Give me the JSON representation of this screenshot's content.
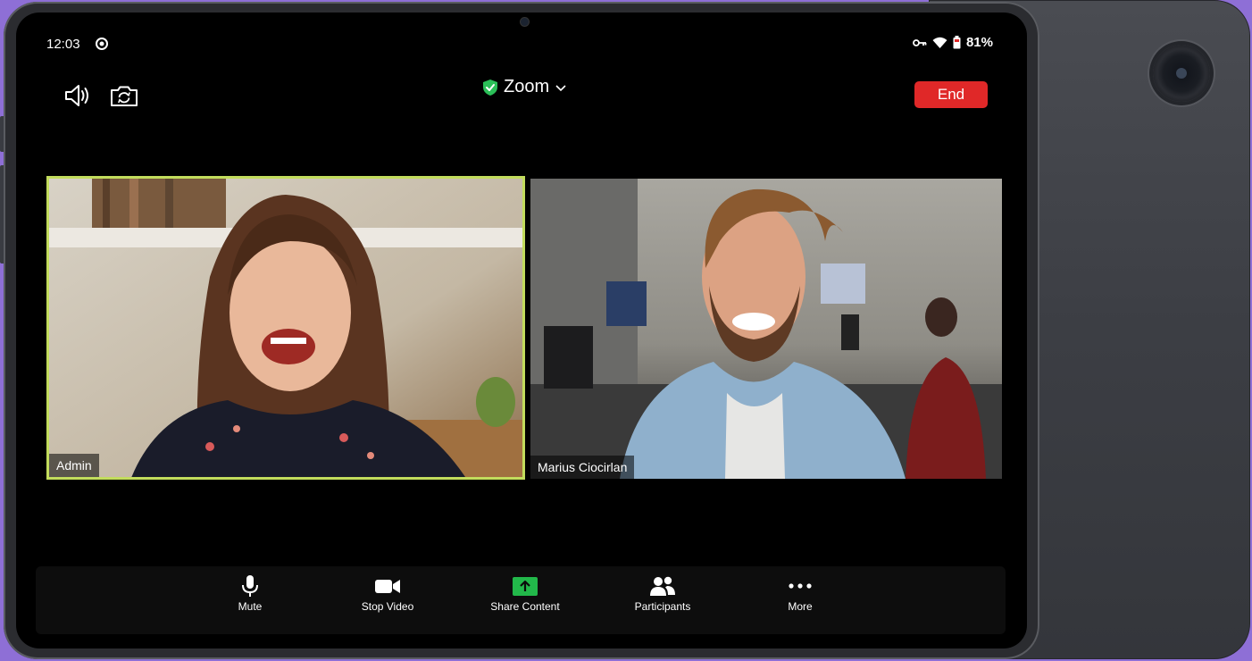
{
  "status_bar": {
    "time": "12:03",
    "battery": "81%"
  },
  "header": {
    "title": "Zoom",
    "end_label": "End"
  },
  "participants": [
    {
      "name": "Admin",
      "active_speaker": true
    },
    {
      "name": "Marius Ciocirlan",
      "active_speaker": false
    }
  ],
  "toolbar": {
    "items": [
      {
        "label": "Mute",
        "icon": "microphone-icon"
      },
      {
        "label": "Stop Video",
        "icon": "video-camera-icon"
      },
      {
        "label": "Share Content",
        "icon": "share-screen-icon"
      },
      {
        "label": "Participants",
        "icon": "participants-icon"
      },
      {
        "label": "More",
        "icon": "more-dots-icon"
      }
    ]
  },
  "colors": {
    "end_button": "#e02828",
    "active_speaker_border": "#c2dc5c",
    "share_green": "#22b84a",
    "shield_green": "#2bbf58"
  }
}
